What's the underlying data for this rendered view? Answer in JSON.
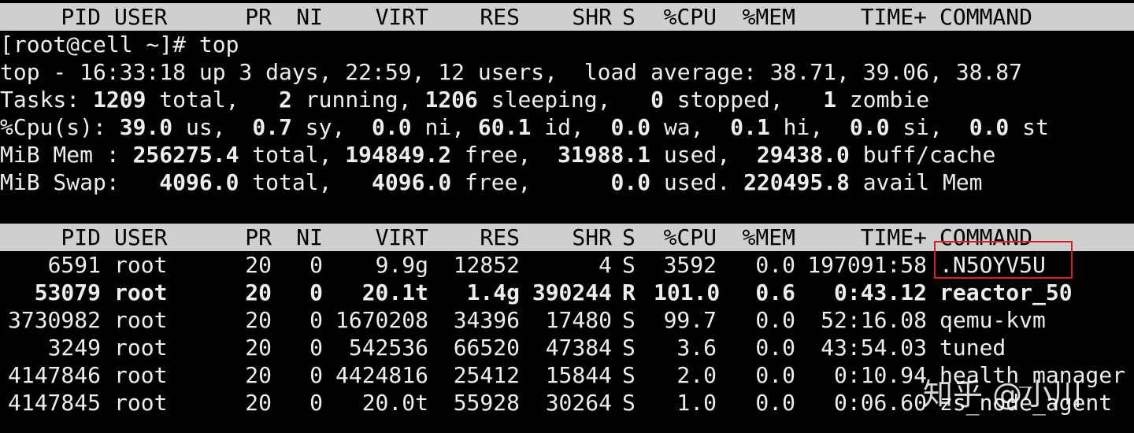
{
  "colors": {
    "background": "#000000",
    "text": "#eeeeee",
    "header_background": "#cfcfcf",
    "header_text": "#000000",
    "highlight_border": "#d81e1e"
  },
  "columns": [
    "PID",
    "USER",
    "PR",
    "NI",
    "VIRT",
    "RES",
    "SHR",
    "S",
    "%CPU",
    "%MEM",
    "TIME+",
    "COMMAND"
  ],
  "prompt": "[root@cell ~]# top",
  "summary": {
    "uptime": {
      "segments": [
        {
          "text": "top - 16:33:18 up 3 days, 22:59, 12 users,  load average: 38.71, 39.06, 38.87",
          "bold": false
        }
      ]
    },
    "tasks": {
      "segments": [
        {
          "text": "Tasks: ",
          "bold": false
        },
        {
          "text": "1209",
          "bold": true
        },
        {
          "text": " total,   ",
          "bold": false
        },
        {
          "text": "2",
          "bold": true
        },
        {
          "text": " running, ",
          "bold": false
        },
        {
          "text": "1206",
          "bold": true
        },
        {
          "text": " sleeping,   ",
          "bold": false
        },
        {
          "text": "0",
          "bold": true
        },
        {
          "text": " stopped,   ",
          "bold": false
        },
        {
          "text": "1",
          "bold": true
        },
        {
          "text": " zombie",
          "bold": false
        }
      ]
    },
    "cpu": {
      "segments": [
        {
          "text": "%Cpu(s): ",
          "bold": false
        },
        {
          "text": "39.0",
          "bold": true
        },
        {
          "text": " us,  ",
          "bold": false
        },
        {
          "text": "0.7",
          "bold": true
        },
        {
          "text": " sy,  ",
          "bold": false
        },
        {
          "text": "0.0",
          "bold": true
        },
        {
          "text": " ni, ",
          "bold": false
        },
        {
          "text": "60.1",
          "bold": true
        },
        {
          "text": " id,  ",
          "bold": false
        },
        {
          "text": "0.0",
          "bold": true
        },
        {
          "text": " wa,  ",
          "bold": false
        },
        {
          "text": "0.1",
          "bold": true
        },
        {
          "text": " hi,  ",
          "bold": false
        },
        {
          "text": "0.0",
          "bold": true
        },
        {
          "text": " si,  ",
          "bold": false
        },
        {
          "text": "0.0",
          "bold": true
        },
        {
          "text": " st",
          "bold": false
        }
      ]
    },
    "mem": {
      "segments": [
        {
          "text": "MiB Mem : ",
          "bold": false
        },
        {
          "text": "256275.4",
          "bold": true
        },
        {
          "text": " total, ",
          "bold": false
        },
        {
          "text": "194849.2",
          "bold": true
        },
        {
          "text": " free,  ",
          "bold": false
        },
        {
          "text": "31988.1",
          "bold": true
        },
        {
          "text": " used,  ",
          "bold": false
        },
        {
          "text": "29438.0",
          "bold": true
        },
        {
          "text": " buff/cache",
          "bold": false
        }
      ]
    },
    "swap": {
      "segments": [
        {
          "text": "MiB Swap:   ",
          "bold": false
        },
        {
          "text": "4096.0",
          "bold": true
        },
        {
          "text": " total,   ",
          "bold": false
        },
        {
          "text": "4096.0",
          "bold": true
        },
        {
          "text": " free,      ",
          "bold": false
        },
        {
          "text": "0.0",
          "bold": true
        },
        {
          "text": " used. ",
          "bold": false
        },
        {
          "text": "220495.8",
          "bold": true
        },
        {
          "text": " avail Mem",
          "bold": false
        }
      ]
    }
  },
  "processes": [
    {
      "pid": "6591",
      "user": "root",
      "pr": "20",
      "ni": "0",
      "virt": "9.9g",
      "res": "12852",
      "shr": "4",
      "s": "S",
      "cpu": "3592",
      "mem": "0.0",
      "time": "197091:58",
      "command": ".N5OYV5U",
      "bold": false
    },
    {
      "pid": "53079",
      "user": "root",
      "pr": "20",
      "ni": "0",
      "virt": "20.1t",
      "res": "1.4g",
      "shr": "390244",
      "s": "R",
      "cpu": "101.0",
      "mem": "0.6",
      "time": "0:43.12",
      "command": "reactor_50",
      "bold": true
    },
    {
      "pid": "3730982",
      "user": "root",
      "pr": "20",
      "ni": "0",
      "virt": "1670208",
      "res": "34396",
      "shr": "17480",
      "s": "S",
      "cpu": "99.7",
      "mem": "0.0",
      "time": "52:16.08",
      "command": "qemu-kvm",
      "bold": false
    },
    {
      "pid": "3249",
      "user": "root",
      "pr": "20",
      "ni": "0",
      "virt": "542536",
      "res": "66520",
      "shr": "47384",
      "s": "S",
      "cpu": "3.6",
      "mem": "0.0",
      "time": "43:54.03",
      "command": "tuned",
      "bold": false
    },
    {
      "pid": "4147846",
      "user": "root",
      "pr": "20",
      "ni": "0",
      "virt": "4424816",
      "res": "25412",
      "shr": "15844",
      "s": "S",
      "cpu": "2.0",
      "mem": "0.0",
      "time": "0:10.94",
      "command": "health_manager",
      "bold": false
    },
    {
      "pid": "4147845",
      "user": "root",
      "pr": "20",
      "ni": "0",
      "virt": "20.0t",
      "res": "55928",
      "shr": "30264",
      "s": "S",
      "cpu": "1.0",
      "mem": "0.0",
      "time": "0:06.60",
      "command": "zs_node_agent",
      "bold": false
    }
  ],
  "watermark": "知乎 @小川"
}
